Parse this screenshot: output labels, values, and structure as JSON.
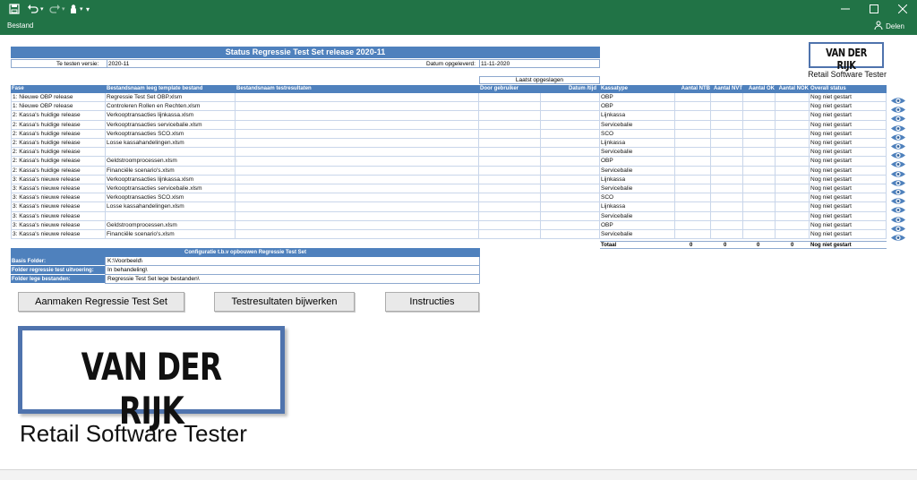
{
  "titlebar": {
    "qa_more": "▾"
  },
  "ribbon": {
    "menu_label": "Bestand",
    "share_label": "Delen"
  },
  "sheet": {
    "title": "Status Regressie Test Set release 2020-11",
    "meta": {
      "version_label": "Te testen versie:",
      "version_value": "2020-11",
      "date_label": "Datum opgeleverd:",
      "date_value": "11-11-2020"
    },
    "last_saved_label": "Laatst opgeslagen",
    "headers": {
      "fase": "Fase",
      "template": "Bestandsnaam leeg template bestand",
      "results": "Bestandsnaam testresultaten",
      "user": "Door gebruiker",
      "datetime": "Datum /tijd",
      "kassatype": "Kassatype",
      "ntb": "Aantal NTB",
      "nvt": "Aantal NVT",
      "ok": "Aantal OK",
      "nok": "Aantal NOK",
      "overall": "Overall status"
    },
    "rows": [
      {
        "fase": "1: Nieuwe OBP release",
        "template": "Regressie Test Set OBP.xlsm",
        "kassatype": "OBP",
        "status": "Nog niet gestart"
      },
      {
        "fase": "1: Nieuwe OBP release",
        "template": "Controleren Rollen en Rechten.xlsm",
        "kassatype": "OBP",
        "status": "Nog niet gestart"
      },
      {
        "fase": "2: Kassa's huidige release",
        "template": "Verkooptransacties lijnkassa.xlsm",
        "kassatype": "Lijnkassa",
        "status": "Nog niet gestart"
      },
      {
        "fase": "2: Kassa's huidige release",
        "template": "Verkooptransacties servicebalie.xlsm",
        "kassatype": "Servicebalie",
        "status": "Nog niet gestart"
      },
      {
        "fase": "2: Kassa's huidige release",
        "template": "Verkooptransacties SCO.xlsm",
        "kassatype": "SCO",
        "status": "Nog niet gestart"
      },
      {
        "fase": "2: Kassa's huidige release",
        "template": "Losse kassahandelingen.xlsm",
        "kassatype": "Lijnkassa",
        "status": "Nog niet gestart"
      },
      {
        "fase": "2: Kassa's huidige release",
        "template": "",
        "kassatype": "Servicebalie",
        "status": "Nog niet gestart"
      },
      {
        "fase": "2: Kassa's huidige release",
        "template": "Geldstroomprocessen.xlsm",
        "kassatype": "OBP",
        "status": "Nog niet gestart"
      },
      {
        "fase": "2: Kassa's huidige release",
        "template": "Financiële scenario's.xlsm",
        "kassatype": "Servicebalie",
        "status": "Nog niet gestart"
      },
      {
        "fase": "3: Kassa's nieuwe release",
        "template": "Verkooptransacties lijnkassa.xlsm",
        "kassatype": "Lijnkassa",
        "status": "Nog niet gestart"
      },
      {
        "fase": "3: Kassa's nieuwe release",
        "template": "Verkooptransacties servicebalie.xlsm",
        "kassatype": "Servicebalie",
        "status": "Nog niet gestart"
      },
      {
        "fase": "3: Kassa's nieuwe release",
        "template": "Verkooptransacties SCO.xlsm",
        "kassatype": "SCO",
        "status": "Nog niet gestart"
      },
      {
        "fase": "3: Kassa's nieuwe release",
        "template": "Losse kassahandelingen.xlsm",
        "kassatype": "Lijnkassa",
        "status": "Nog niet gestart"
      },
      {
        "fase": "3: Kassa's nieuwe release",
        "template": "",
        "kassatype": "Servicebalie",
        "status": "Nog niet gestart"
      },
      {
        "fase": "3: Kassa's nieuwe release",
        "template": "Geldstroomprocessen.xlsm",
        "kassatype": "OBP",
        "status": "Nog niet gestart"
      },
      {
        "fase": "3: Kassa's nieuwe release",
        "template": "Financiële scenario's.xlsm",
        "kassatype": "Servicebalie",
        "status": "Nog niet gestart"
      }
    ],
    "totals": {
      "label": "Totaal",
      "ntb": "0",
      "nvt": "0",
      "ok": "0",
      "nok": "0",
      "status": "Nog niet gestart"
    },
    "config": {
      "header": "Configuratie t.b.v opbouwen Regressie Test Set",
      "base_label": "Basis Folder:",
      "base_value": "K:\\Voorbeeld\\",
      "running_label": "Folder regressie test uitvoering:",
      "running_value": "In behandeling\\",
      "empty_label": "Folder lege bestanden:",
      "empty_value": "Regressie Test Set lege bestanden\\"
    },
    "buttons": {
      "create": "Aanmaken Regressie Test Set",
      "update": "Testresultaten bijwerken",
      "instructions": "Instructies"
    },
    "logo": {
      "name": "VAN DER RIJK",
      "tagline": "Retail Software Tester"
    }
  },
  "colors": {
    "excel_green": "#217346",
    "header_blue": "#4f81bd",
    "logo_border": "#4f73ad"
  }
}
